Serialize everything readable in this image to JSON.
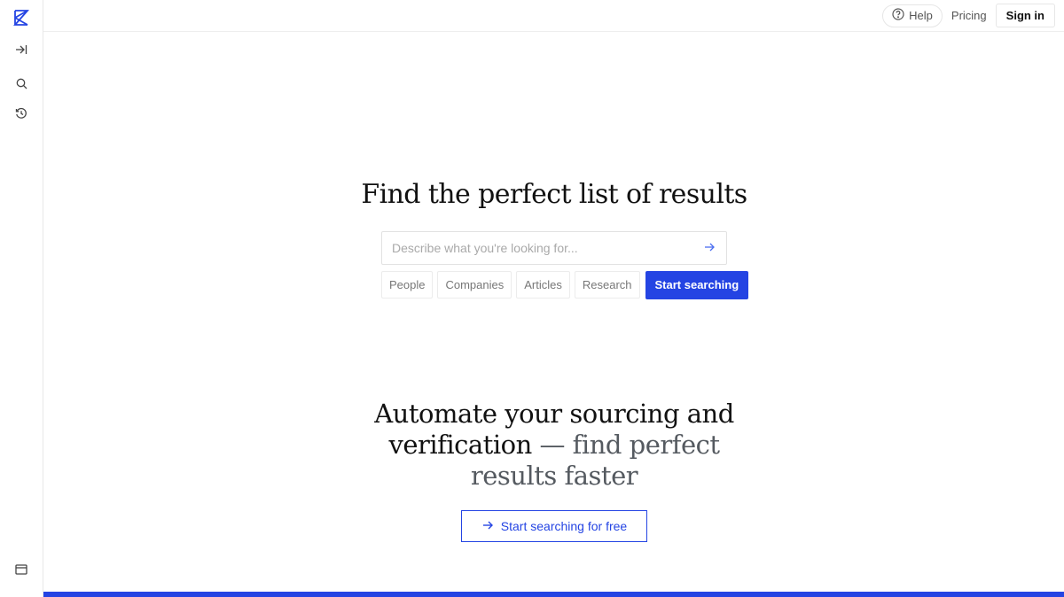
{
  "colors": {
    "accent": "#2444e3",
    "logo": "#2444e3",
    "border": "#e6e6e6"
  },
  "sidebar": {
    "logo_icon": "exa-logo-icon",
    "items": [
      {
        "icon": "expand-sidebar-icon"
      },
      {
        "icon": "search-icon"
      },
      {
        "icon": "history-icon"
      }
    ],
    "bottom_icon": "panel-icon"
  },
  "topbar": {
    "help_label": "Help",
    "pricing_label": "Pricing",
    "signin_label": "Sign in"
  },
  "hero": {
    "title": "Find the perfect list of results",
    "search_placeholder": "Describe what you're looking for...",
    "search_value": "",
    "chips": [
      "People",
      "Companies",
      "Articles",
      "Research"
    ],
    "start_button": "Start searching"
  },
  "section2": {
    "line1": "Automate your sourcing and",
    "line2_dark": "verification",
    "line2_muted": " — find perfect",
    "line3": "results faster",
    "cta_label": "Start searching for free"
  }
}
